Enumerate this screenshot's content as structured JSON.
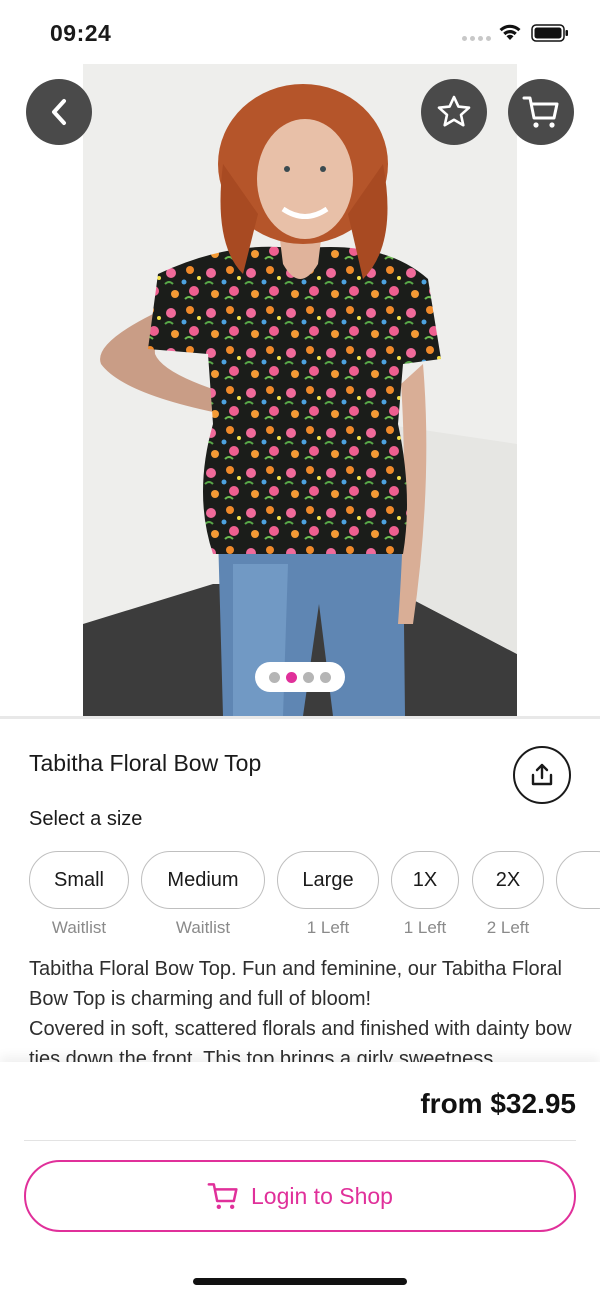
{
  "status": {
    "time": "09:24"
  },
  "product": {
    "title": "Tabitha Floral Bow Top",
    "select_size_label": "Select a size",
    "description": "Tabitha Floral Bow Top. Fun and feminine, our Tabitha Floral Bow Top is charming and full of bloom!\nCovered in soft, scattered florals and finished with dainty bow ties down the front. This top brings a girly sweetness",
    "price": "from $32.95"
  },
  "sizes": [
    {
      "label": "Small",
      "note": "Waitlist"
    },
    {
      "label": "Medium",
      "note": "Waitlist"
    },
    {
      "label": "Large",
      "note": "1 Left"
    },
    {
      "label": "1X",
      "note": "1 Left"
    },
    {
      "label": "2X",
      "note": "2 Left"
    }
  ],
  "gallery": {
    "image_count": 4,
    "active_index": 1
  },
  "actions": {
    "login_label": "Login to Shop"
  },
  "colors": {
    "accent": "#e0309a",
    "icon_button_bg": "#4a4a4a"
  },
  "icons": [
    "back-icon",
    "star-icon",
    "cart-icon",
    "share-icon",
    "wifi-icon",
    "battery-icon"
  ]
}
